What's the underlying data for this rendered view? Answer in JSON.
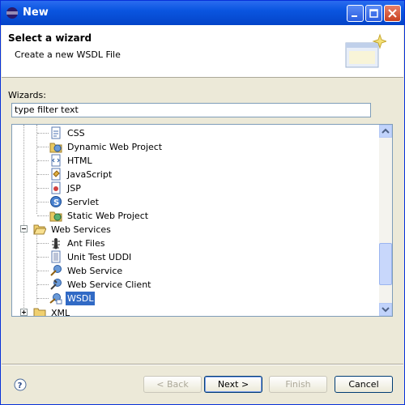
{
  "window": {
    "title": "New"
  },
  "header": {
    "title": "Select a wizard",
    "subtitle": "Create a new WSDL File"
  },
  "wizards_label": "Wizards:",
  "filter": {
    "value": "type filter text"
  },
  "tree": {
    "items": [
      {
        "label": "CSS",
        "icon": "css-file-icon"
      },
      {
        "label": "Dynamic Web Project",
        "icon": "web-project-icon"
      },
      {
        "label": "HTML",
        "icon": "html-file-icon"
      },
      {
        "label": "JavaScript",
        "icon": "javascript-file-icon"
      },
      {
        "label": "JSP",
        "icon": "jsp-file-icon"
      },
      {
        "label": "Servlet",
        "icon": "servlet-icon"
      },
      {
        "label": "Static Web Project",
        "icon": "static-web-project-icon"
      },
      {
        "label": "Web Services",
        "icon": "folder-open-icon",
        "expanded": true
      },
      {
        "label": "Ant Files",
        "icon": "ant-icon"
      },
      {
        "label": "Unit Test UDDI",
        "icon": "uddi-icon"
      },
      {
        "label": "Web Service",
        "icon": "web-service-icon"
      },
      {
        "label": "Web Service Client",
        "icon": "web-service-client-icon"
      },
      {
        "label": "WSDL",
        "icon": "wsdl-icon",
        "selected": true
      },
      {
        "label": "XML",
        "icon": "folder-icon",
        "expanded": false
      }
    ]
  },
  "buttons": {
    "back": "< Back",
    "next": "Next >",
    "finish": "Finish",
    "cancel": "Cancel"
  },
  "colors": {
    "selection": "#316ac5",
    "titlebar": "#0a55e0"
  }
}
